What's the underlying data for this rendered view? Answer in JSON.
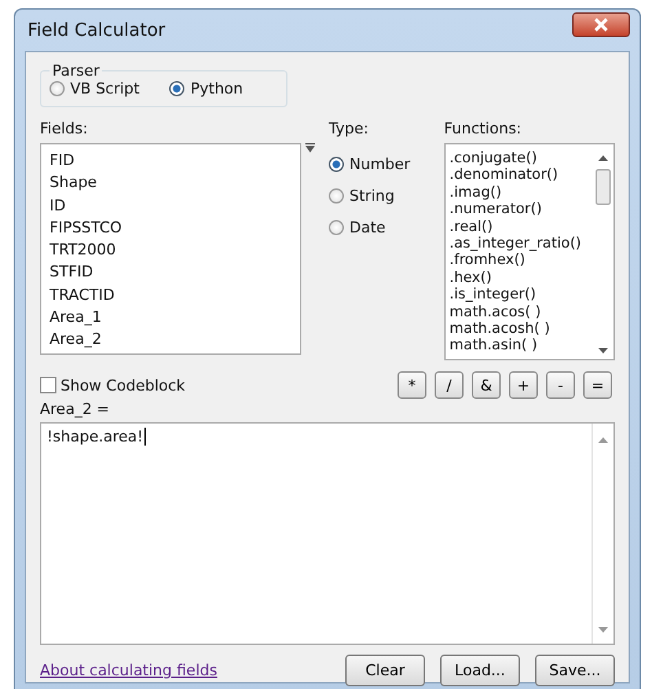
{
  "window": {
    "title": "Field Calculator"
  },
  "parser": {
    "label": "Parser",
    "options": [
      {
        "label": "VB Script",
        "selected": false
      },
      {
        "label": "Python",
        "selected": true
      }
    ]
  },
  "fields": {
    "label": "Fields:",
    "items": [
      "FID",
      "Shape",
      "ID",
      "FIPSSTCO",
      "TRT2000",
      "STFID",
      "TRACTID",
      "Area_1",
      "Area_2"
    ]
  },
  "type": {
    "label": "Type:",
    "options": [
      {
        "label": "Number",
        "selected": true
      },
      {
        "label": "String",
        "selected": false
      },
      {
        "label": "Date",
        "selected": false
      }
    ]
  },
  "functions": {
    "label": "Functions:",
    "items": [
      ".conjugate()",
      ".denominator()",
      ".imag()",
      ".numerator()",
      ".real()",
      ".as_integer_ratio()",
      ".fromhex()",
      ".hex()",
      ".is_integer()",
      "math.acos( )",
      "math.acosh( )",
      "math.asin( )"
    ]
  },
  "show_codeblock": {
    "label": "Show Codeblock",
    "checked": false
  },
  "operators": [
    "*",
    "/",
    "&",
    "+",
    "-",
    "="
  ],
  "expression": {
    "label": "Area_2 =",
    "value": "!shape.area!"
  },
  "help_link": "About calculating fields",
  "buttons": [
    "Clear",
    "Load...",
    "Save..."
  ]
}
